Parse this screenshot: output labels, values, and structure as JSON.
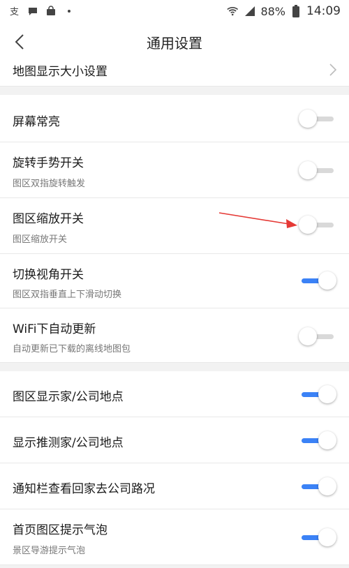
{
  "status_bar": {
    "left_icons": [
      "alipay-icon",
      "message-icon",
      "shopping-bag-icon",
      "dot-icon"
    ],
    "right_icons": [
      "wifi-4g-icon",
      "signal-icon",
      "battery-icon"
    ],
    "battery_percent": "88%",
    "time": "14:09"
  },
  "nav": {
    "back_icon": "chevron-left-icon",
    "title": "通用设置"
  },
  "sections": [
    {
      "items": [
        {
          "title": "地图显示大小设置",
          "subtitle": "",
          "control": "chevron"
        }
      ]
    },
    {
      "items": [
        {
          "title": "屏幕常亮",
          "subtitle": "",
          "control": "toggle",
          "on": false
        },
        {
          "title": "旋转手势开关",
          "subtitle": "图区双指旋转触发",
          "control": "toggle",
          "on": false
        },
        {
          "title": "图区缩放开关",
          "subtitle": "图区缩放开关",
          "control": "toggle",
          "on": false
        },
        {
          "title": "切换视角开关",
          "subtitle": "图区双指垂直上下滑动切换",
          "control": "toggle",
          "on": true
        },
        {
          "title": "WiFi下自动更新",
          "subtitle": "自动更新已下载的离线地图包",
          "control": "toggle",
          "on": false
        }
      ]
    },
    {
      "items": [
        {
          "title": "图区显示家/公司地点",
          "subtitle": "",
          "control": "toggle",
          "on": true
        },
        {
          "title": "显示推测家/公司地点",
          "subtitle": "",
          "control": "toggle",
          "on": true
        },
        {
          "title": "通知栏查看回家去公司路况",
          "subtitle": "",
          "control": "toggle",
          "on": true
        },
        {
          "title": "首页图区提示气泡",
          "subtitle": "景区导游提示气泡",
          "control": "toggle",
          "on": true
        }
      ]
    }
  ],
  "colors": {
    "accent": "#3b82f6",
    "toggle_off_track": "#d9d9d9",
    "annotation_arrow": "#e53935"
  }
}
